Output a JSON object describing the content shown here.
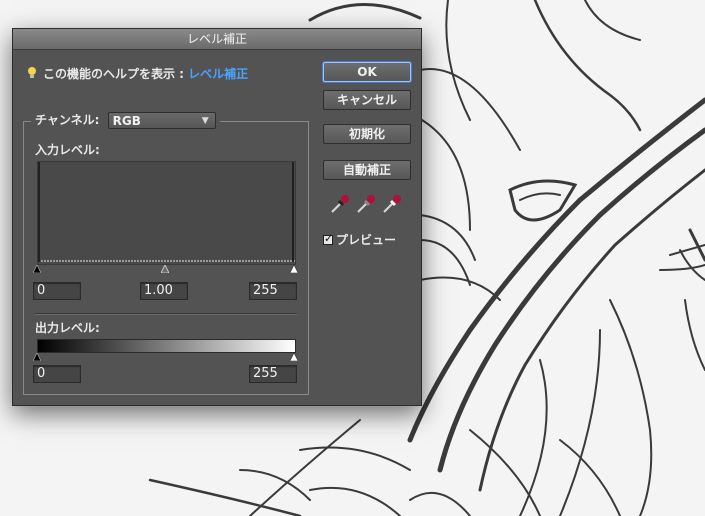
{
  "dialog": {
    "title": "レベル補正",
    "help_text": "この機能のヘルプを表示 : ",
    "help_link": "レベル補正",
    "help_icon": "lightbulb-icon"
  },
  "buttons": {
    "ok": "OK",
    "cancel": "キャンセル",
    "reset": "初期化",
    "auto": "自動補正"
  },
  "channel": {
    "label": "チャンネル:",
    "value": "RGB"
  },
  "input_levels": {
    "label": "入力レベル:",
    "black": "0",
    "gamma": "1.00",
    "white": "255"
  },
  "output_levels": {
    "label": "出力レベル:",
    "black": "0",
    "white": "255"
  },
  "eyedroppers": [
    "black-point-eyedropper-icon",
    "gray-point-eyedropper-icon",
    "white-point-eyedropper-icon"
  ],
  "preview": {
    "label": "プレビュー",
    "checked": true
  },
  "colors": {
    "dialog_bg": "#535353",
    "accent": "#4aa3ff",
    "eyedropper": "#b0103a"
  }
}
